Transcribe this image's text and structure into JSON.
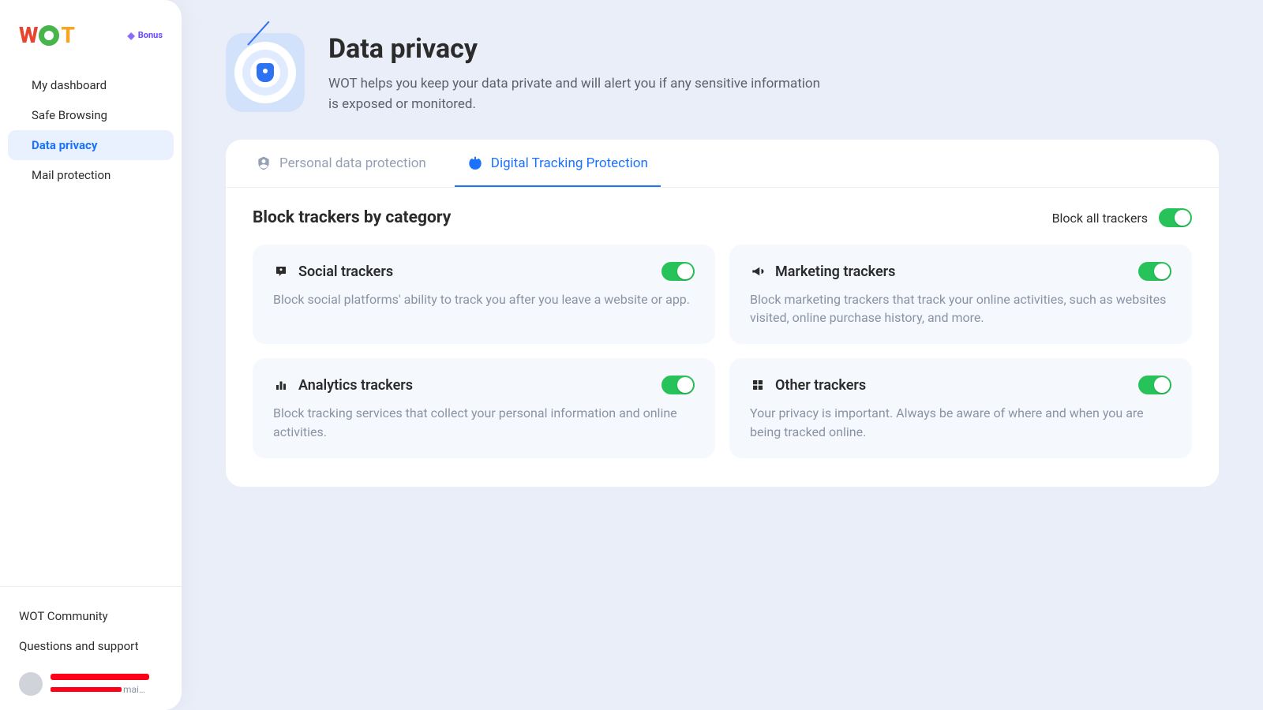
{
  "sidebar": {
    "bonus_label": "Bonus",
    "nav": [
      {
        "label": "My dashboard",
        "active": false
      },
      {
        "label": "Safe Browsing",
        "active": false
      },
      {
        "label": "Data privacy",
        "active": true
      },
      {
        "label": "Mail protection",
        "active": false
      }
    ],
    "community_link": "WOT Community",
    "support_link": "Questions and support",
    "email_tail": "mai…"
  },
  "header": {
    "title": "Data privacy",
    "description": "WOT helps you keep your data private and will alert you if any sensitive information is exposed or monitored."
  },
  "tabs": {
    "personal": "Personal data protection",
    "digital": "Digital Tracking Protection"
  },
  "section": {
    "title": "Block trackers by category",
    "block_all_label": "Block all trackers"
  },
  "trackers": {
    "social": {
      "title": "Social trackers",
      "desc": "Block social platforms' ability to track you after you leave a website or app."
    },
    "marketing": {
      "title": "Marketing trackers",
      "desc": "Block marketing trackers that track your online activities, such as websites visited, online purchase history, and more."
    },
    "analytics": {
      "title": "Analytics trackers",
      "desc": "Block tracking services that collect your personal information and online activities."
    },
    "other": {
      "title": "Other trackers",
      "desc": "Your privacy is important. Always be aware of where and when you are being tracked online."
    }
  }
}
